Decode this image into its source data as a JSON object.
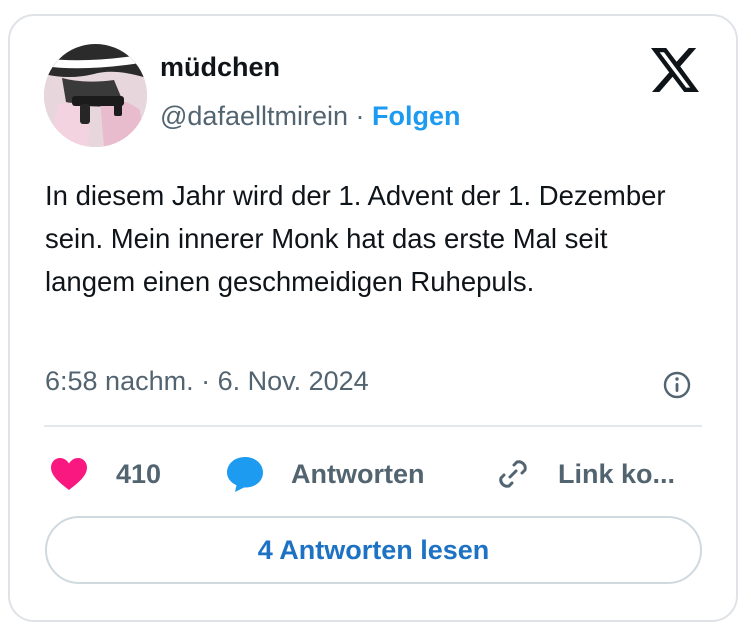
{
  "tweet": {
    "display_name": "müdchen",
    "handle": "@dafaelltmirein",
    "separator": "·",
    "follow_label": "Folgen",
    "text": "In diesem Jahr wird der 1. Advent der 1. Dezember sein. Mein innerer Monk hat das erste Mal seit langem einen geschmeidigen Ruhepuls.",
    "timestamp": "6:58 nachm. · 6. Nov. 2024"
  },
  "actions": {
    "like_count": "410",
    "reply_label": "Antworten",
    "copy_link_label": "Link ko..."
  },
  "read_replies_label": "4 Antworten lesen",
  "colors": {
    "accent": "#1d9bf0",
    "like": "#f91880",
    "muted": "#536471",
    "text": "#0f1419",
    "border": "#dfe3e7"
  },
  "icons": {
    "brand": "x-logo-icon",
    "info": "info-icon",
    "like": "heart-icon",
    "reply": "speech-bubble-icon",
    "copy": "link-icon"
  }
}
